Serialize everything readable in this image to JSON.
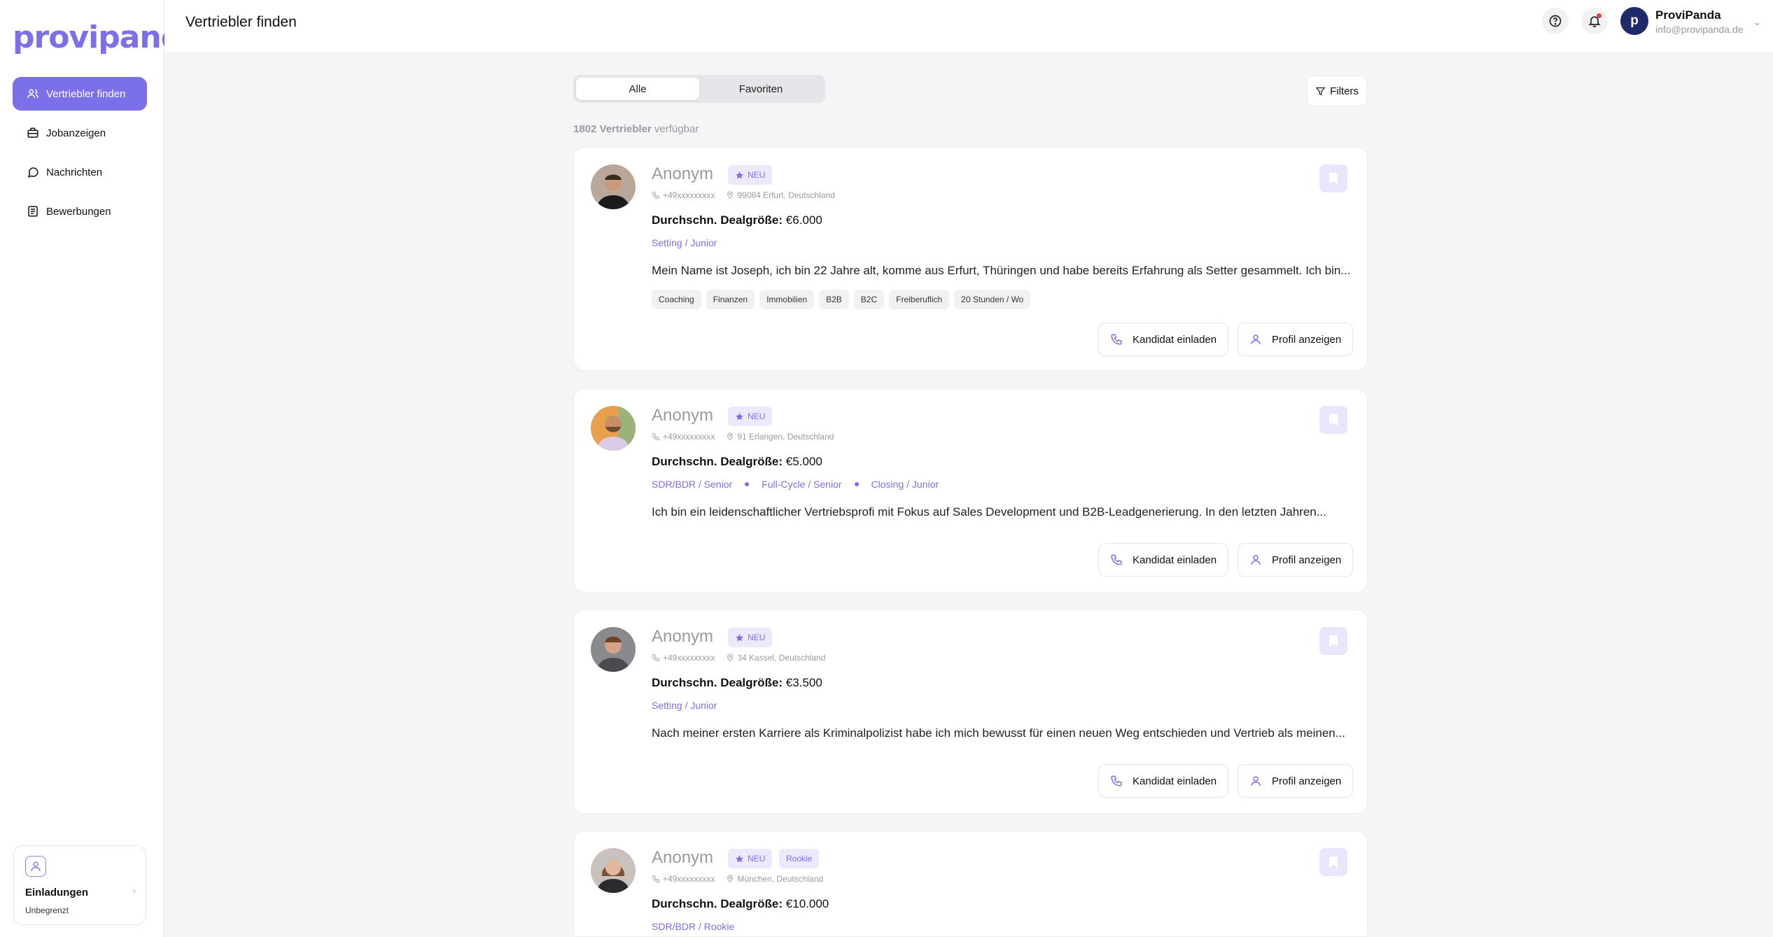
{
  "brand": {
    "logo": "provipanda",
    "accent": "#7c70e8"
  },
  "sidebar": {
    "items": [
      {
        "label": "Vertriebler finden",
        "icon": "users-icon",
        "active": true
      },
      {
        "label": "Jobanzeigen",
        "icon": "briefcase-icon"
      },
      {
        "label": "Nachrichten",
        "icon": "message-icon"
      },
      {
        "label": "Bewerbungen",
        "icon": "applications-icon"
      }
    ],
    "invite": {
      "title": "Einladungen",
      "subtitle": "Unbegrenzt"
    }
  },
  "header": {
    "title": "Vertriebler finden",
    "user": {
      "initial": "p",
      "name": "ProviPanda",
      "email": "info@provipanda.de"
    }
  },
  "tabs": [
    {
      "label": "Alle",
      "active": true
    },
    {
      "label": "Favoriten",
      "active": false
    }
  ],
  "filters_label": "Filters",
  "count": {
    "number": "1802 Vertriebler",
    "suffix": "verfügbar"
  },
  "actions": {
    "invite": "Kandidat einladen",
    "profile": "Profil anzeigen"
  },
  "candidates": [
    {
      "name": "Anonym",
      "badges": [
        "NEU"
      ],
      "phone": "+49xxxxxxxxx",
      "location": "99084 Erfurt, Deutschland",
      "deal_label": "Durchschn. Dealgröße:",
      "deal_value": "€6.000",
      "roles": [
        "Setting / Junior"
      ],
      "description": "Mein Name ist Joseph, ich bin 22 Jahre alt, komme aus Erfurt, Thüringen und habe bereits Erfahrung als Setter gesammelt. Ich bin...",
      "tags": [
        "Coaching",
        "Finanzen",
        "Immobilien",
        "B2B",
        "B2C",
        "Freiberuflich",
        "20 Stunden / Wo"
      ]
    },
    {
      "name": "Anonym",
      "badges": [
        "NEU"
      ],
      "phone": "+49xxxxxxxxx",
      "location": "91 Erlangen, Deutschland",
      "deal_label": "Durchschn. Dealgröße:",
      "deal_value": "€5.000",
      "roles": [
        "SDR/BDR / Senior",
        "Full-Cycle / Senior",
        "Closing / Junior"
      ],
      "description": "Ich bin ein leidenschaftlicher Vertriebsprofi mit Fokus auf Sales Development und B2B-Leadgenerierung. In den letzten Jahren...",
      "tags": []
    },
    {
      "name": "Anonym",
      "badges": [
        "NEU"
      ],
      "phone": "+49xxxxxxxxx",
      "location": "34 Kassel, Deutschland",
      "deal_label": "Durchschn. Dealgröße:",
      "deal_value": "€3.500",
      "roles": [
        "Setting / Junior"
      ],
      "description": "Nach meiner ersten Karriere als Kriminalpolizist habe ich mich bewusst für einen neuen Weg entschieden und Vertrieb als meinen...",
      "tags": []
    },
    {
      "name": "Anonym",
      "badges": [
        "NEU",
        "Rookie"
      ],
      "phone": "+49xxxxxxxxx",
      "location": "München, Deutschland",
      "deal_label": "Durchschn. Dealgröße:",
      "deal_value": "€10.000",
      "roles": [
        "SDR/BDR / Rookie"
      ],
      "description": "",
      "tags": []
    }
  ]
}
